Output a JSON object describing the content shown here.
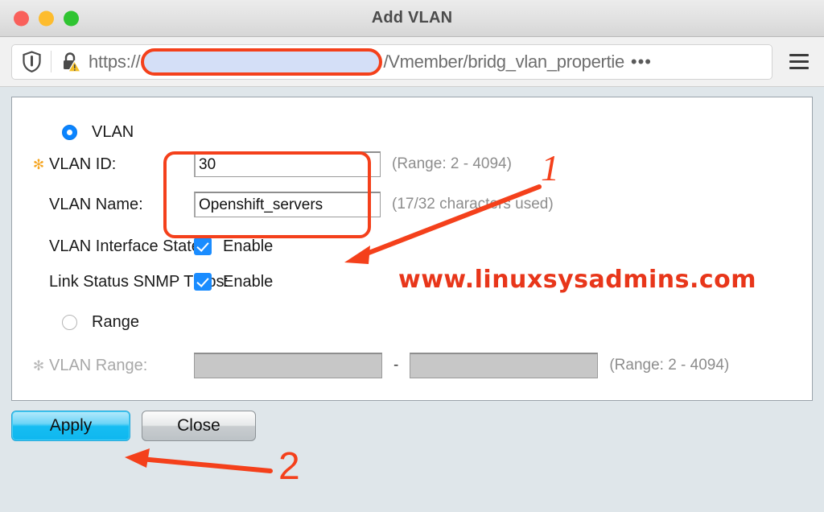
{
  "window": {
    "title": "Add VLAN",
    "traffic_lights": [
      {
        "name": "close",
        "color": "#f9605b"
      },
      {
        "name": "minimize",
        "color": "#fdbc2e"
      },
      {
        "name": "maximize",
        "color": "#2fc431"
      }
    ]
  },
  "browser": {
    "shield_icon": "shield-icon",
    "lock_warning_icon": "lock-warning-icon",
    "url_scheme": "https://",
    "url_redacted_placeholder": "",
    "url_path": "/Vmember/bridg_vlan_propertie",
    "page_actions_icon": "•••",
    "menu_icon": "hamburger-menu-icon"
  },
  "form": {
    "mode_vlan": {
      "label": "VLAN",
      "selected": true
    },
    "mode_range": {
      "label": "Range",
      "selected": false
    },
    "required_marker": "✻",
    "vlan_id": {
      "label": "VLAN ID:",
      "value": "30",
      "hint": "(Range: 2 - 4094)",
      "required": true
    },
    "vlan_name": {
      "label": "VLAN Name:",
      "value": "Openshift_servers",
      "hint": "(17/32 characters used)",
      "required": false
    },
    "interface_state": {
      "label": "VLAN Interface State:",
      "checkbox_label": "Enable",
      "checked": true
    },
    "snmp_traps": {
      "label": "Link Status SNMP Traps:",
      "checkbox_label": "Enable",
      "checked": true
    },
    "vlan_range": {
      "label": "VLAN Range:",
      "start_value": "",
      "end_value": "",
      "separator": "-",
      "hint": "(Range: 2 - 4094)",
      "disabled": true
    }
  },
  "footer": {
    "apply_label": "Apply",
    "close_label": "Close"
  },
  "annotations": {
    "number_one": "1",
    "number_two": "2",
    "watermark": "www.linuxsysadmins.com",
    "highlight_color": "#f4401b"
  }
}
